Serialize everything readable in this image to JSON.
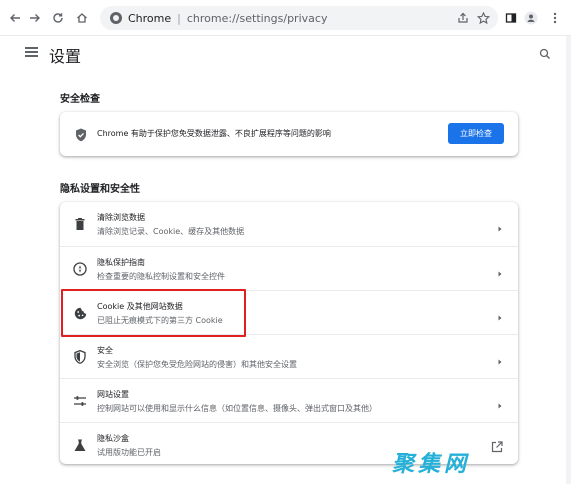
{
  "browser": {
    "site_label": "Chrome",
    "url": "chrome://settings/privacy",
    "icons": [
      "back-icon",
      "forward-icon",
      "reload-icon",
      "home-icon",
      "share-icon",
      "star-icon",
      "sidepanel-icon",
      "profile-icon",
      "more-icon"
    ]
  },
  "header": {
    "title": "设置"
  },
  "safety_check": {
    "section_title": "安全检查",
    "description": "Chrome 有助于保护您免受数据泄露、不良扩展程序等问题的影响",
    "button_label": "立即检查",
    "icon": "shield-check-icon"
  },
  "privacy": {
    "section_title": "隐私设置和安全性",
    "rows": [
      {
        "title": "清除浏览数据",
        "subtitle": "清除浏览记录、Cookie、缓存及其他数据",
        "icon": "trash-icon",
        "action": "arrow"
      },
      {
        "title": "隐私保护指南",
        "subtitle": "检查重要的隐私控制设置和安全控件",
        "icon": "compass-icon",
        "action": "arrow"
      },
      {
        "title": "Cookie 及其他网站数据",
        "subtitle": "已阻止无痕模式下的第三方 Cookie",
        "icon": "cookie-icon",
        "action": "arrow"
      },
      {
        "title": "安全",
        "subtitle": "安全浏览（保护您免受危险网站的侵害）和其他安全设置",
        "icon": "shield-icon",
        "action": "arrow"
      },
      {
        "title": "网站设置",
        "subtitle": "控制网站可以使用和显示什么信息（如位置信息、摄像头、弹出式窗口及其他）",
        "icon": "sliders-icon",
        "action": "arrow"
      },
      {
        "title": "隐私沙盒",
        "subtitle": "试用版功能已开启",
        "icon": "flask-icon",
        "action": "external"
      }
    ]
  },
  "colors": {
    "accent": "#1a73e8",
    "highlight": "#e02020",
    "watermark": "#25b0d8"
  },
  "watermark_text": "聚集网"
}
